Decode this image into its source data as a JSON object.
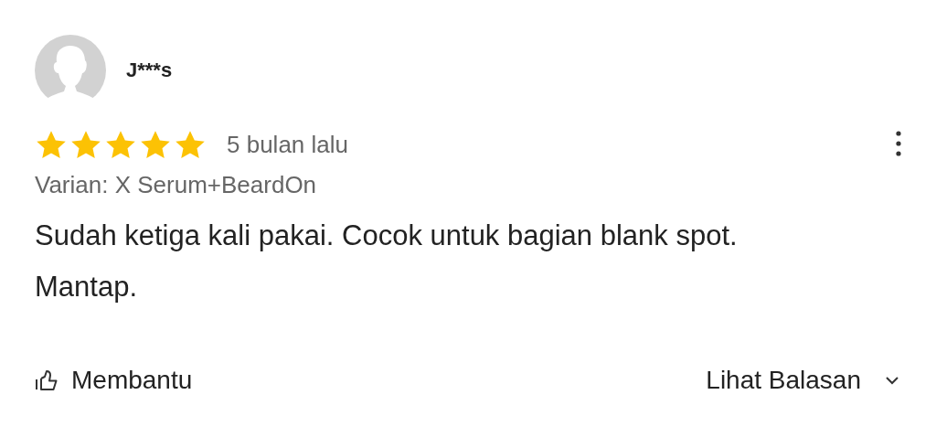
{
  "review": {
    "user": "J***s",
    "stars": 5,
    "time": "5 bulan lalu",
    "variant": "Varian: X Serum+BeardOn",
    "text": "Sudah ketiga kali pakai. Cocok untuk bagian blank spot. Mantap."
  },
  "actions": {
    "helpful": "Membantu",
    "replies": "Lihat Balasan"
  }
}
